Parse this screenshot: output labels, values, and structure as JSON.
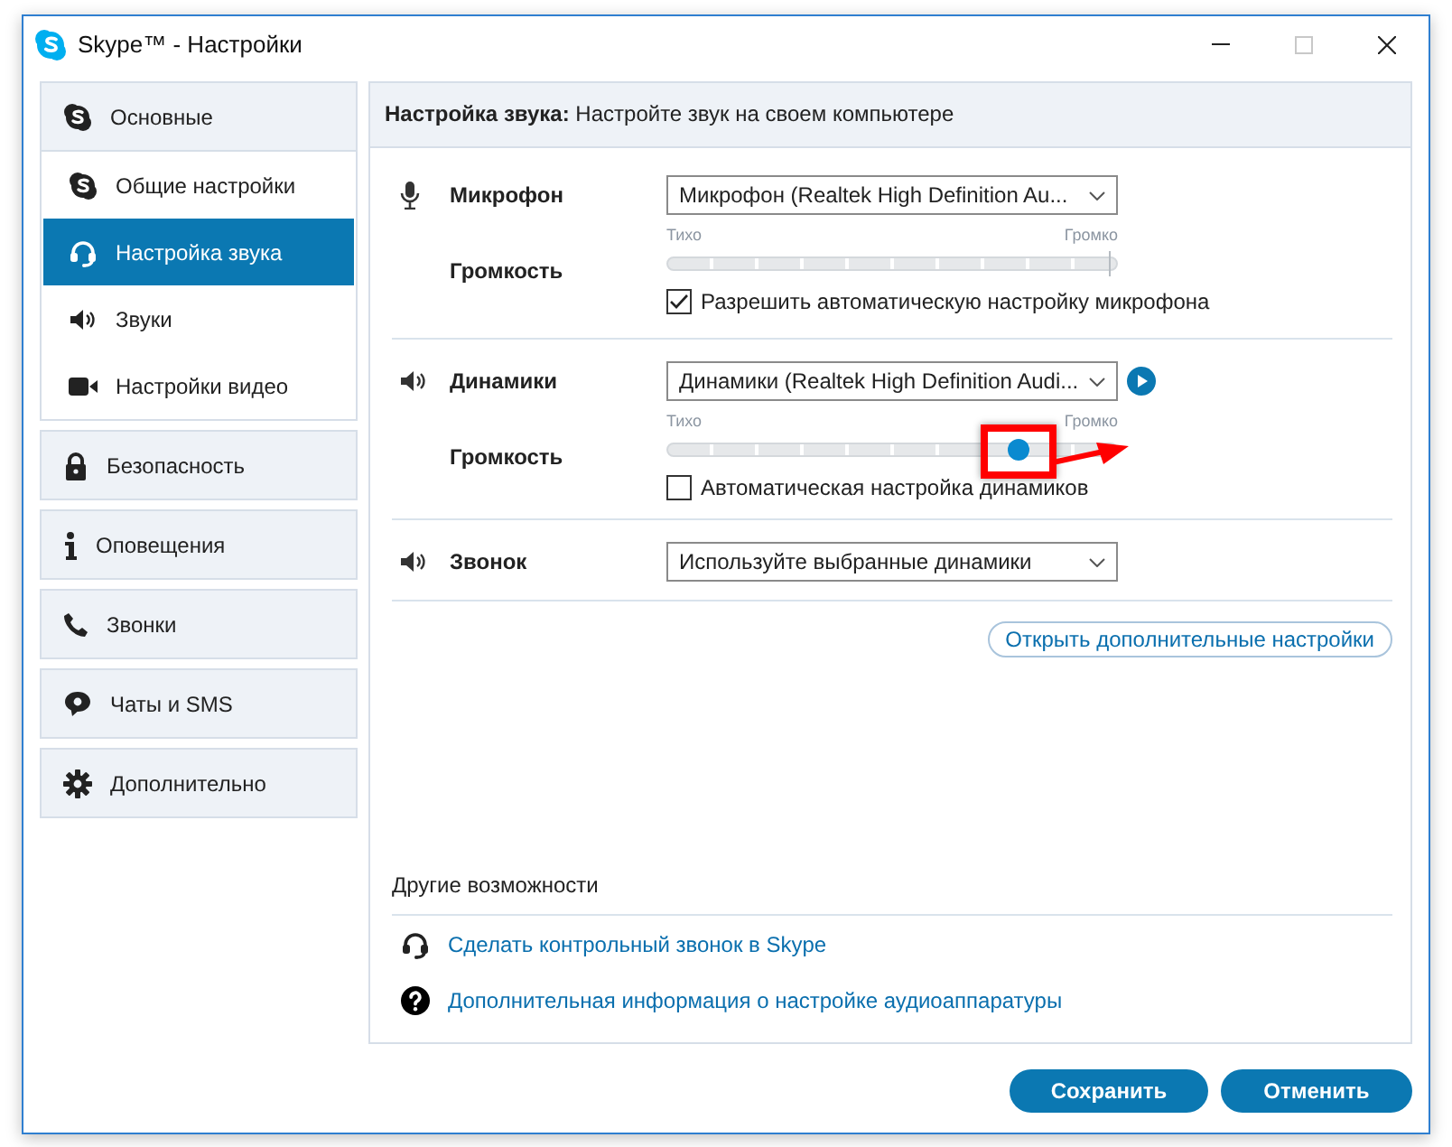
{
  "window": {
    "title": "Skype™ - Настройки",
    "controls": [
      {
        "kind": "minimize",
        "disabled": false
      },
      {
        "kind": "maximize",
        "disabled": true
      },
      {
        "kind": "close",
        "disabled": false
      }
    ]
  },
  "sidebar": {
    "groups": [
      {
        "label": "Основные",
        "expanded": true,
        "children": [
          {
            "label": "Общие настройки",
            "selected": false
          },
          {
            "label": "Настройка звука",
            "selected": true
          },
          {
            "label": "Звуки",
            "selected": false
          },
          {
            "label": "Настройки видео",
            "selected": false
          }
        ]
      },
      {
        "label": "Безопасность",
        "expanded": false
      },
      {
        "label": "Оповещения",
        "expanded": false
      },
      {
        "label": "Звонки",
        "expanded": false
      },
      {
        "label": "Чаты и SMS",
        "expanded": false
      },
      {
        "label": "Дополнительно",
        "expanded": false
      }
    ]
  },
  "header": "**Настройка звука:** Настройте звук на своем компьютере",
  "devices": [
    {
      "kind": "microphone",
      "label": "Микрофон",
      "device": "Микрофон (Realtek High Definition Au...",
      "volume_label": "Громкость",
      "low": "Тихо",
      "high": "Громко",
      "level": 0.98,
      "highlighted": false,
      "checkbox": {
        "label": "Разрешить автоматическую настройку микрофона",
        "checked": true
      }
    },
    {
      "kind": "speaker",
      "label": "Динамики",
      "device": "Динамики (Realtek High Definition Audi...",
      "volume_label": "Громкость",
      "low": "Тихо",
      "high": "Громко",
      "level": 0.78,
      "highlighted": true,
      "checkbox": {
        "label": "Автоматическая настройка динамиков",
        "checked": false
      }
    },
    {
      "kind": "ringer",
      "label": "Звонок",
      "device": "Используйте выбранные динамики"
    }
  ],
  "advanced_button": "Открыть дополнительные настройки",
  "other": {
    "title": "Другие возможности",
    "links": [
      "Сделать контрольный звонок в Skype",
      "Дополнительная информация о настройке аудиоаппаратуры"
    ]
  },
  "buttons": [
    "Сохранить",
    "Отменить"
  ]
}
